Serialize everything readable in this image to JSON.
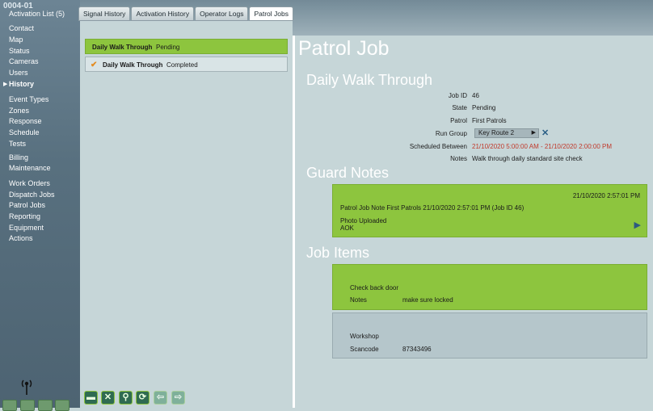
{
  "sidebar": {
    "site_id": "0004-01",
    "items": [
      {
        "label": "Activation List (5)"
      },
      {
        "label": "Contact"
      },
      {
        "label": "Map"
      },
      {
        "label": "Status"
      },
      {
        "label": "Cameras"
      },
      {
        "label": "Users"
      },
      {
        "label": "History"
      },
      {
        "label": "Event Types"
      },
      {
        "label": "Zones"
      },
      {
        "label": "Response"
      },
      {
        "label": "Schedule"
      },
      {
        "label": "Tests"
      },
      {
        "label": "Billing"
      },
      {
        "label": "Maintenance"
      },
      {
        "label": "Work Orders"
      },
      {
        "label": "Dispatch Jobs"
      },
      {
        "label": "Patrol Jobs"
      },
      {
        "label": "Reporting"
      },
      {
        "label": "Equipment"
      },
      {
        "label": "Actions"
      }
    ],
    "active_item": "History"
  },
  "tabs": [
    {
      "label": "Signal History"
    },
    {
      "label": "Activation History"
    },
    {
      "label": "Operator Logs"
    },
    {
      "label": "Patrol Jobs"
    }
  ],
  "active_tab": "Patrol Jobs",
  "job_list": [
    {
      "name": "Daily Walk Through",
      "status": "Pending",
      "selected": true
    },
    {
      "name": "Daily Walk Through",
      "status": "Completed",
      "selected": false,
      "icon": "check-icon"
    }
  ],
  "toolbar": {
    "buttons": [
      {
        "icon": "minus-icon",
        "glyph": "▬"
      },
      {
        "icon": "close-icon",
        "glyph": "✕"
      },
      {
        "icon": "search-icon",
        "glyph": "⚲"
      },
      {
        "icon": "refresh-icon",
        "glyph": "⟳"
      },
      {
        "icon": "arrow-left-icon",
        "glyph": "⇦"
      },
      {
        "icon": "arrow-right-icon",
        "glyph": "⇨"
      }
    ]
  },
  "detail": {
    "page_title": "Patrol Job",
    "job_name": "Daily Walk Through",
    "fields": {
      "job_id_label": "Job ID",
      "job_id": "46",
      "state_label": "State",
      "state": "Pending",
      "patrol_label": "Patrol",
      "patrol": "First Patrols",
      "run_group_label": "Run Group",
      "run_group": "Key Route 2",
      "scheduled_label": "Scheduled Between",
      "scheduled": "21/10/2020 5:00:00 AM - 21/10/2020 2:00:00 PM",
      "notes_label": "Notes",
      "notes": "Walk through daily standard site check"
    },
    "colors": {
      "scheduled_text": "#c0392b",
      "accent_green": "#8dc53e"
    }
  },
  "guard_notes": {
    "title": "Guard Notes",
    "note": {
      "timestamp": "21/10/2020 2:57:01 PM",
      "text": "Patrol Job Note  First Patrols 21/10/2020 2:57:01 PM (Job ID 46)",
      "line2": "Photo Uploaded",
      "line3": "AOK"
    }
  },
  "job_items": {
    "title": "Job Items",
    "items": [
      {
        "name": "Check back door",
        "notes_label": "Notes",
        "notes": "make sure locked"
      },
      {
        "name": "Workshop",
        "scancode_label": "Scancode",
        "scancode": "87343496"
      }
    ]
  }
}
